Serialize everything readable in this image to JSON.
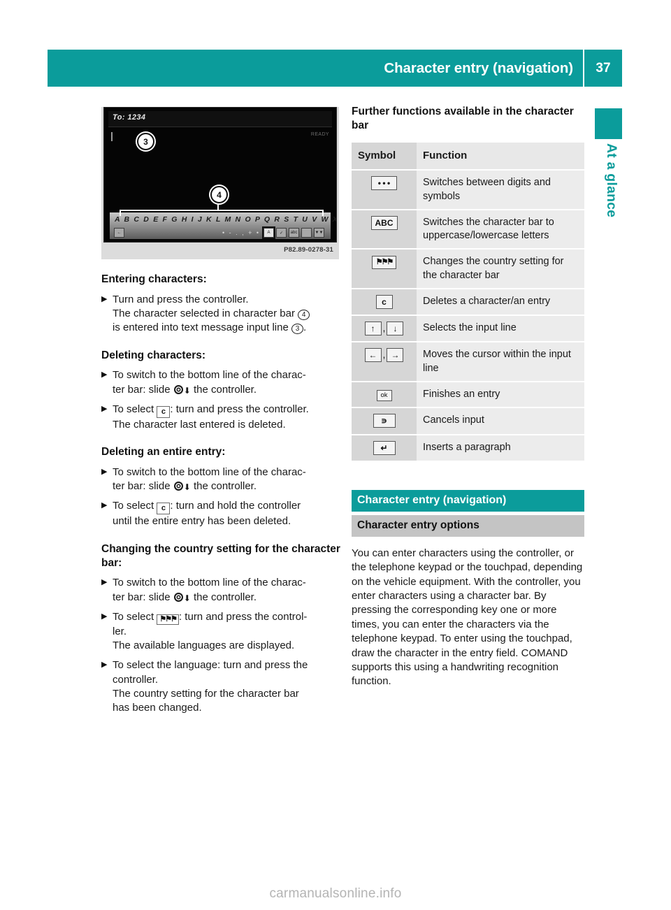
{
  "header": {
    "title": "Character entry (navigation)",
    "page_number": "37",
    "accent_color": "#0b9c9b"
  },
  "side_tab": {
    "label": "At a glance"
  },
  "figure": {
    "caption": "P82.89-0278-31",
    "screen": {
      "to_line": "To: 1234",
      "status": "READY",
      "callouts": [
        "3",
        "4"
      ],
      "character_bar_letters": "A B C D E F G H I J K L M N O P Q R S T U V W X Y Z",
      "ok_key": "ok",
      "bottom_keys": [
        "",
        "ABC",
        "abc",
        "",
        ""
      ]
    }
  },
  "left_column": {
    "sections": [
      {
        "heading": "Entering characters:",
        "steps": [
          {
            "marker": "X",
            "lines": [
              "Turn and press the controller.",
              "The character selected in character bar (4)",
              "is entered into text message input line (3)."
            ]
          }
        ]
      },
      {
        "heading": "Deleting characters:",
        "steps": [
          {
            "marker": "X",
            "lines": [
              "To switch to the bottom line of the charac-",
              "ter bar: slide (controller-icon) the controller."
            ]
          },
          {
            "marker": "X",
            "lines": [
              "To select [c]: turn and press the controller.",
              "The character last entered is deleted."
            ]
          }
        ]
      },
      {
        "heading": "Deleting an entire entry:",
        "steps": [
          {
            "marker": "X",
            "lines": [
              "To switch to the bottom line of the charac-",
              "ter bar: slide (controller-icon) the controller."
            ]
          },
          {
            "marker": "X",
            "lines": [
              "To select [c]: turn and hold the controller",
              "until the entire entry has been deleted."
            ]
          }
        ]
      },
      {
        "heading": "Changing the country setting for the character bar:",
        "steps": [
          {
            "marker": "X",
            "lines": [
              "To switch to the bottom line of the charac-",
              "ter bar: slide (controller-icon) the controller."
            ]
          },
          {
            "marker": "X",
            "lines": [
              "To select [flag]: turn and press the control-",
              "ler.",
              "The available languages are displayed."
            ]
          },
          {
            "marker": "X",
            "lines": [
              "To select the language: turn and press the",
              "controller.",
              "The country setting for the character bar",
              "has been changed."
            ]
          }
        ]
      }
    ],
    "text": {
      "entering_heading": "Entering characters:",
      "deleting_heading": "Deleting characters:",
      "deleting_entry_heading": "Deleting an entire entry:",
      "country_heading": "Changing the country setting for the character bar:",
      "s1_l1": "Turn and press the controller.",
      "s1_l2a": "The character selected in character bar",
      "s1_l2b": "4",
      "s1_l3a": "is entered into text message input line",
      "s1_l3b": "3",
      "s1_l3c": ".",
      "slide_a": "To switch to the bottom line of the charac-",
      "slide_b": "ter bar: slide",
      "slide_c": "the controller.",
      "del_a": "To select",
      "del_sym": "c",
      "del_b": ": turn and press the controller.",
      "del_c": "The character last entered is deleted.",
      "hold_b": ": turn and hold the controller",
      "hold_c": "until the entire entry has been deleted.",
      "flag_b": ": turn and press the control-",
      "flag_c": "ler.",
      "flag_d": "The available languages are displayed.",
      "lang_a": "To select the language: turn and press the",
      "lang_b": "controller.",
      "lang_c": "The country setting for the character bar",
      "lang_d": "has been changed."
    }
  },
  "right_column": {
    "heading": "Further functions available in the character bar",
    "table": {
      "columns": [
        "Symbol",
        "Function"
      ],
      "rows": [
        {
          "symbol": "• • •",
          "symbol_name": "dots-key",
          "function": "Switches between digits and symbols"
        },
        {
          "symbol": "ABC",
          "symbol_name": "abc-key",
          "function": "Switches the character bar to uppercase/lowercase letters"
        },
        {
          "symbol": "flags",
          "symbol_name": "flag-key",
          "function": "Changes the country setting for the character bar"
        },
        {
          "symbol": "c",
          "symbol_name": "clear-key",
          "function": "Deletes a character/an entry"
        },
        {
          "symbol": "↑ , ↓",
          "symbol_name": "up-down-arrow-keys",
          "function": "Selects the input line"
        },
        {
          "symbol": "← , →",
          "symbol_name": "left-right-arrow-keys",
          "function": "Moves the cursor within the input line"
        },
        {
          "symbol": "ok",
          "symbol_name": "ok-key",
          "function": "Finishes an entry"
        },
        {
          "symbol": "↩",
          "symbol_name": "back-arrow-key",
          "function": "Cancels input"
        },
        {
          "symbol": "↵",
          "symbol_name": "return-key",
          "function": "Inserts a paragraph"
        }
      ]
    },
    "teal_heading": "Character entry (navigation)",
    "gray_heading": "Character entry options",
    "paragraph": "You can enter characters using the controller, or the telephone keypad or the touchpad, depending on the vehicle equipment. With the controller, you enter characters using a character bar. By pressing the corresponding key one or more times, you can enter the characters via the telephone keypad. To enter using the touchpad, draw the character in the entry field. COMAND supports this using a handwriting recognition function."
  },
  "footer": {
    "watermark": "carmanualsonline.info"
  }
}
